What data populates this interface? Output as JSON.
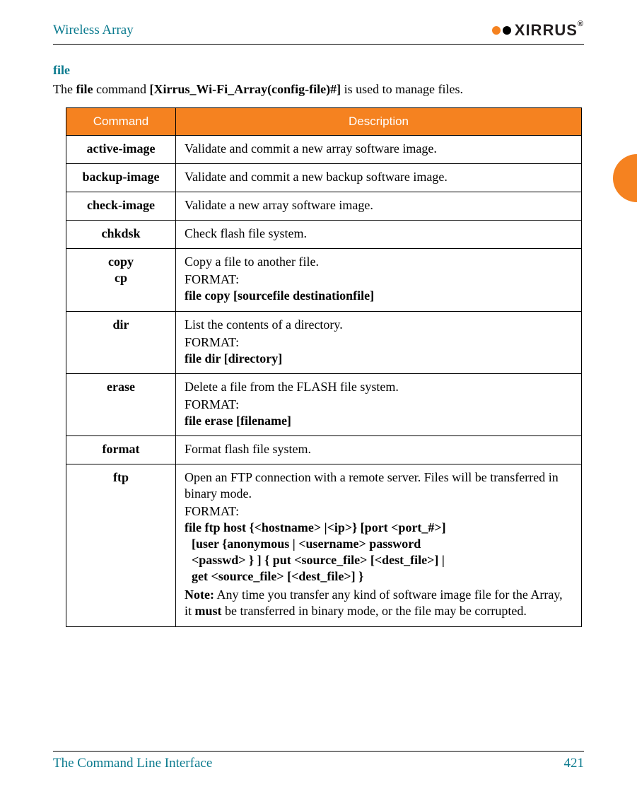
{
  "header": {
    "title": "Wireless Array",
    "logo_text": "XIRRUS"
  },
  "section": {
    "heading": "file",
    "intro_pre": "The ",
    "intro_cmd": "file",
    "intro_mid": " command ",
    "intro_prompt": "[Xirrus_Wi-Fi_Array(config-file)#]",
    "intro_post": " is used to manage files."
  },
  "table": {
    "head_command": "Command",
    "head_description": "Description",
    "rows": {
      "active_image": {
        "cmd": "active-image",
        "desc": "Validate and commit a new array software image."
      },
      "backup_image": {
        "cmd": "backup-image",
        "desc": "Validate and commit a new backup software image."
      },
      "check_image": {
        "cmd": "check-image",
        "desc": "Validate a new array software image."
      },
      "chkdsk": {
        "cmd": "chkdsk",
        "desc": " Check flash file system."
      },
      "copy": {
        "cmd1": "copy",
        "cmd2": "cp",
        "desc": "Copy a file to another file.",
        "format_label": "FORMAT:",
        "syntax": "file copy [sourcefile destinationfile]"
      },
      "dir": {
        "cmd": "dir",
        "desc": "List the contents of a directory.",
        "format_label": "FORMAT:",
        "syntax": "file dir [directory]"
      },
      "erase": {
        "cmd": "erase",
        "desc": "Delete a file from the FLASH file system.",
        "format_label": "FORMAT:",
        "syntax": "file erase [filename]"
      },
      "format": {
        "cmd": "format",
        "desc": "Format flash file system."
      },
      "ftp": {
        "cmd": "ftp",
        "desc": "Open an FTP connection with a remote server. Files will be transferred in binary mode.",
        "format_label": "FORMAT:",
        "syntax_l1": "file ftp host {<hostname> |<ip>} [port <port_#>]",
        "syntax_l2": "[user {anonymous | <username> password",
        "syntax_l3": "<passwd> } ] { put <source_file> [<dest_file>] |",
        "syntax_l4": "get <source_file> [<dest_file>] }",
        "note_label": "Note:",
        "note_pre": " Any time you transfer any kind of software image file for the Array, it ",
        "note_must": "must",
        "note_post": " be transferred in binary mode, or the file may be corrupted."
      }
    }
  },
  "footer": {
    "left": "The Command Line Interface",
    "right": "421"
  }
}
